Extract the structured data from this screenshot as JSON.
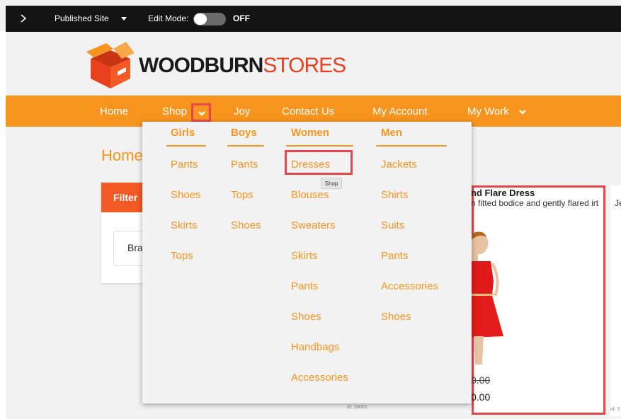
{
  "topbar": {
    "site_label": "Published Site",
    "edit_mode_label": "Edit Mode:",
    "edit_mode_state": "OFF"
  },
  "brand": {
    "part1": "WOODBURN",
    "part2": "STORES"
  },
  "nav": {
    "items": [
      "Home",
      "Shop",
      "Joy",
      "Contact Us",
      "My Account",
      "My Work"
    ]
  },
  "page": {
    "heading": "Home"
  },
  "filter": {
    "title": "Filter",
    "brand_select": "Bra"
  },
  "dropdown": {
    "columns": [
      {
        "title": "Girls",
        "items": [
          "Pants",
          "Shoes",
          "Skirts",
          "Tops"
        ]
      },
      {
        "title": "Boys",
        "items": [
          "Pants",
          "Tops",
          "Shoes"
        ]
      },
      {
        "title": "Women",
        "items": [
          "Dresses",
          "Blouses",
          "Sweaters",
          "Skirts",
          "Pants",
          "Shoes",
          "Handbags",
          "Accessories"
        ]
      },
      {
        "title": "Men",
        "items": [
          "Jackets",
          "Shirts",
          "Suits",
          "Pants",
          "Accessories",
          "Shoes"
        ]
      }
    ],
    "tooltip": "Shop"
  },
  "product": {
    "title": "nd Flare Dress",
    "description": "n fitted bodice and gently flared irt",
    "old_price": "0.00",
    "price": "0.00",
    "id_label": "id: 10001"
  },
  "product2": {
    "title_fragment": "Je",
    "id_label": "id: 3"
  },
  "colors": {
    "accent": "#f7941d",
    "highlight": "#e8464d",
    "filter_header": "#f15a24",
    "topbar": "#141414"
  }
}
